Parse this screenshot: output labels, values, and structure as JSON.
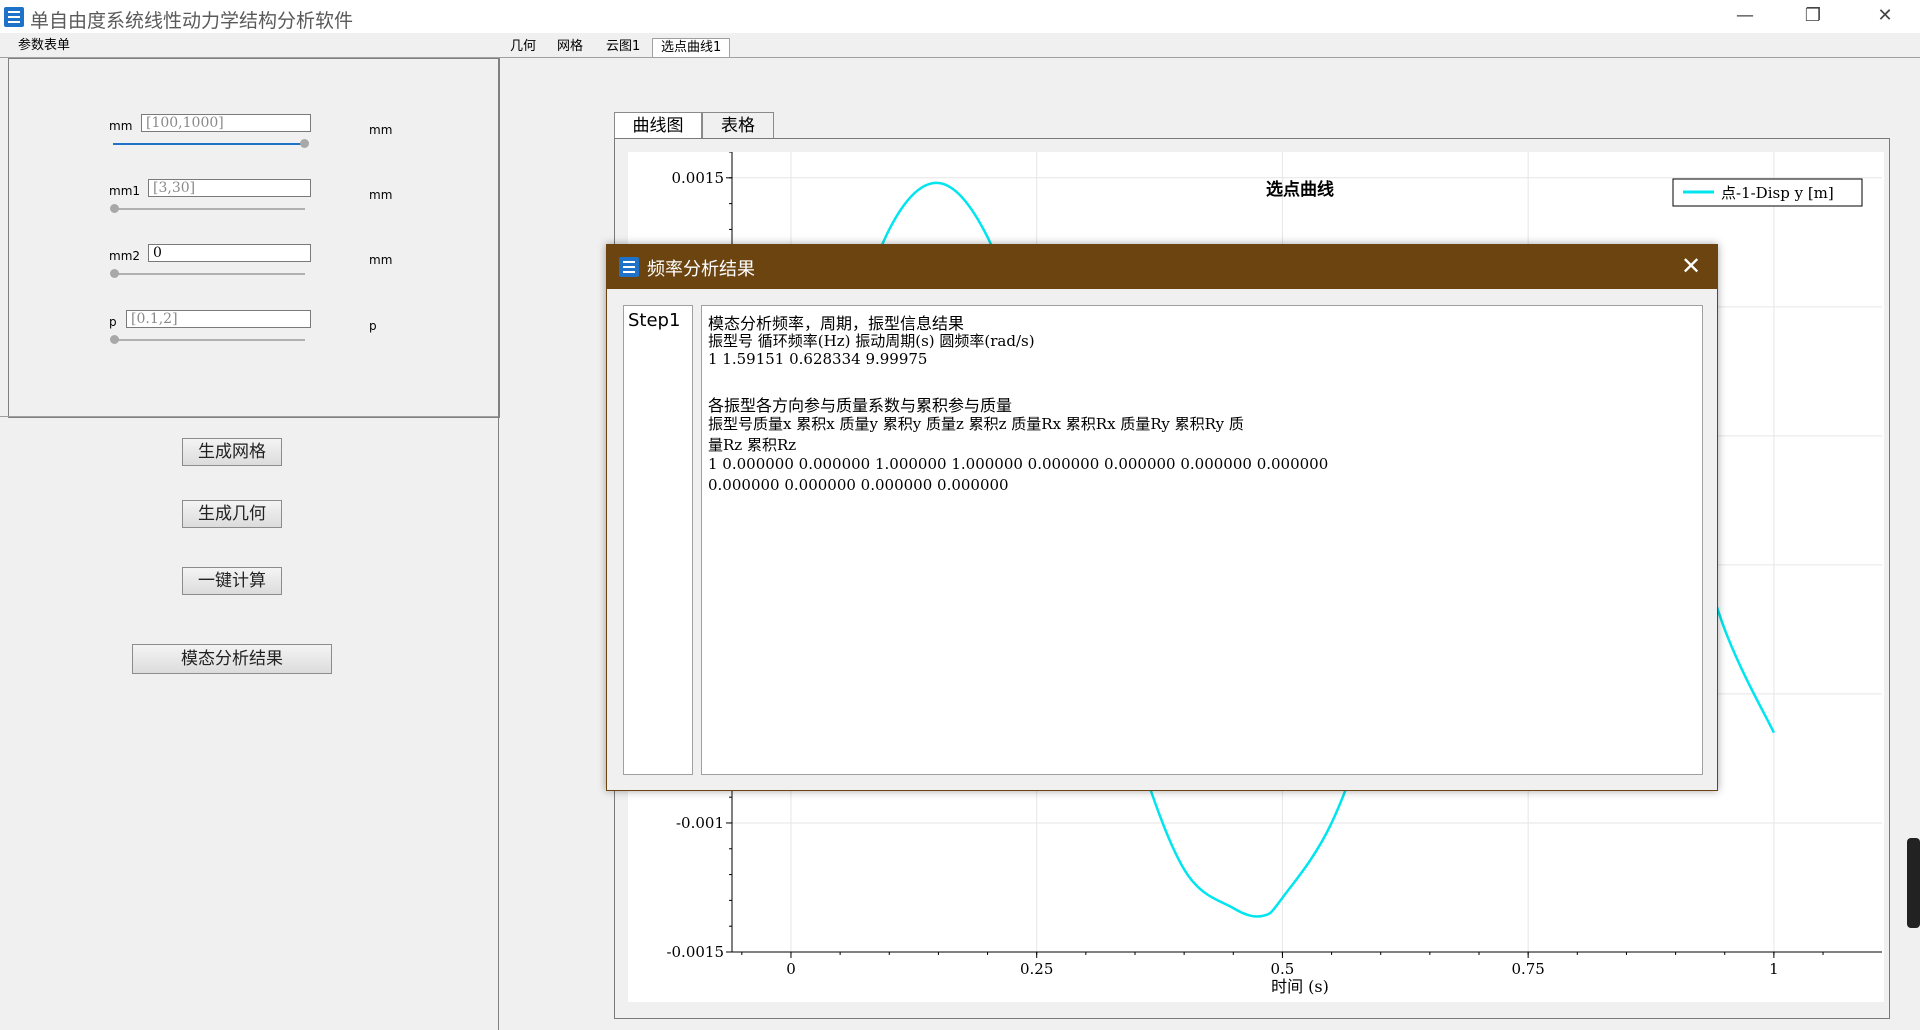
{
  "window": {
    "title": "单自由度系统线性动力学结构分析软件",
    "minimize": "—",
    "restore": "❐",
    "close": "✕"
  },
  "left_tab": "参数表单",
  "top_tabs": [
    "几何",
    "网格",
    "云图1",
    "选点曲线1"
  ],
  "params": [
    {
      "label": "mm",
      "value": "[100,1000]",
      "unit": "mm",
      "slider": 1.0
    },
    {
      "label": "mm1",
      "value": "[3,30]",
      "unit": "mm",
      "slider": 0.0
    },
    {
      "label": "mm2",
      "value": "0",
      "unit": "mm",
      "slider": 0.0
    },
    {
      "label": "p",
      "value": "[0.1,2]",
      "unit": "p",
      "slider": 0.0
    }
  ],
  "buttons": {
    "mesh": "生成网格",
    "geometry": "生成几何",
    "compute": "一键计算",
    "modal": "模态分析结果"
  },
  "chart_tabs": [
    "曲线图",
    "表格"
  ],
  "chart_data": {
    "type": "line",
    "title": "选点曲线",
    "xlabel": "时间 (s)",
    "ylabel": "",
    "xlim": [
      -0.06,
      1.11
    ],
    "ylim": [
      -0.0015,
      0.0016
    ],
    "xticks": [
      "0",
      "0.25",
      "0.5",
      "0.75",
      "1"
    ],
    "yticks": [
      "0.0015",
      "-0.001",
      "-0.0015"
    ],
    "series": [
      {
        "name": "点-1-Disp y [m]",
        "color": "#00e5ee",
        "x": [
          0,
          0.05,
          0.1,
          0.15,
          0.2,
          0.25,
          0.3,
          0.35,
          0.4,
          0.45,
          0.48,
          0.5,
          0.55,
          0.6,
          0.65,
          0.7,
          0.75,
          0.8,
          0.85,
          0.9,
          0.95,
          1.0
        ],
        "y": [
          0.0,
          0.00074,
          0.0013,
          0.00148,
          0.00127,
          0.00072,
          0.0,
          -0.00069,
          -0.00118,
          -0.00133,
          -0.00136,
          -0.00129,
          -0.001,
          -0.00048,
          0.00015,
          0.00075,
          0.00112,
          0.00117,
          0.00088,
          0.00036,
          -0.00025,
          -0.00065
        ]
      }
    ]
  },
  "dialog": {
    "title": "频率分析结果",
    "close": "✕",
    "step": "Step1",
    "lines": [
      "模态分析频率，周期，振型信息结果",
      "振型号              循环频率(Hz)     振动周期(s)      圆频率(rad/s)",
      "1                   1.59151             0.628334             9.99975",
      "",
      "各振型各方向参与质量系数与累积参与质量",
      "振型号质量x       累积x       质量y       累积y       质量z       累积z       质量Rx       累积Rx       质量Ry       累积Ry       质",
      "量Rz      累积Rz",
      "1         0.000000      0.000000      1.000000      1.000000      0.000000      0.000000      0.000000      0.000000",
      "0.000000      0.000000      0.000000      0.000000"
    ]
  }
}
